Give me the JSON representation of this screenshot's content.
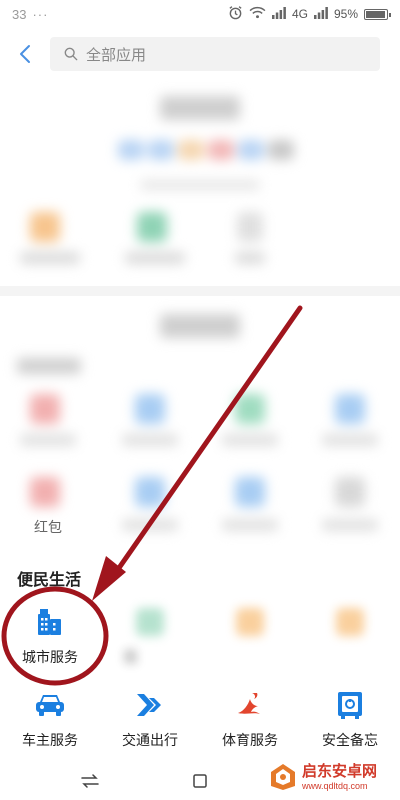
{
  "status_bar": {
    "time": "33",
    "dots": "···",
    "network": "4G",
    "battery": "95%",
    "battery_level": 0.95
  },
  "top_bar": {
    "search_placeholder": "全部应用"
  },
  "partial": {
    "hongbao_label": "红包",
    "city_peek": "医"
  },
  "convenience": {
    "title": "便民生活",
    "city_service": "城市服务"
  },
  "bottom_row": {
    "car_service": "车主服务",
    "traffic": "交通出行",
    "sports": "体育服务",
    "safety": "安全备忘"
  },
  "watermark": {
    "title": "启东安卓网",
    "url": "www.qdltdq.com"
  },
  "colors": {
    "accent_blue": "#1b7fe0",
    "annotation_red": "#a0151d",
    "sports_red": "#e2452e"
  }
}
